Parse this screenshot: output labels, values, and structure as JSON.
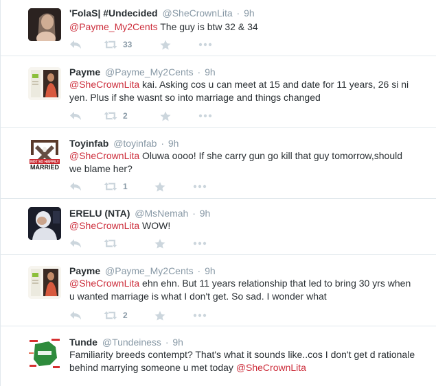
{
  "tweets": [
    {
      "fullname": "'FolaS| #Undecided",
      "username": "@SheCrownLita",
      "time": "9h",
      "mention": "@Payme_My2Cents",
      "text": " The guy is btw 32 & 34",
      "retweets": "33",
      "avatar_icon": "profile-photo"
    },
    {
      "fullname": "Payme",
      "username": "@Payme_My2Cents",
      "time": "9h",
      "mention": "@SheCrownLita",
      "text": " kai. Asking cos u can meet at 15 and date for 11 years, 26 si ni yen. Plus if she wasnt so into marriage and things changed",
      "retweets": "2",
      "avatar_icon": "book-cover"
    },
    {
      "fullname": "Toyinfab",
      "username": "@toyinfab",
      "time": "9h",
      "mention": "@SheCrownLita",
      "text": " Oluwa oooo! If she carry gun go kill that guy tomorrow,should we blame her?",
      "retweets": "1",
      "avatar_icon": "not-so-happily-married-logo",
      "avatar_text": "NOT SO HAPPILY MARRIED"
    },
    {
      "fullname": "ERELU (NTA)",
      "username": "@MsNemah",
      "time": "9h",
      "mention": "@SheCrownLita",
      "text": " WOW!",
      "retweets": "",
      "avatar_icon": "baby-photo"
    },
    {
      "fullname": "Payme",
      "username": "@Payme_My2Cents",
      "time": "9h",
      "mention": "@SheCrownLita",
      "text": " ehn ehn. But 11 years relationship that led to bring 30 yrs when u wanted marriage is what I don't get. So sad. I wonder what",
      "retweets": "2",
      "avatar_icon": "book-cover"
    },
    {
      "fullname": "Tunde",
      "username": "@Tundeiness",
      "time": "9h",
      "text": "Familiarity breeds contempt? That's what it sounds like..cos I don't get d rationale behind marrying someone u met today  ",
      "mention": "@SheCrownLita",
      "retweets": "",
      "avatar_icon": "nigeria-map-wordcloud"
    }
  ],
  "colors": {
    "mention": "#cc2c3a",
    "meta": "#8899a6",
    "action_icon": "#ccd6dd",
    "divider": "#e1e8ed"
  }
}
